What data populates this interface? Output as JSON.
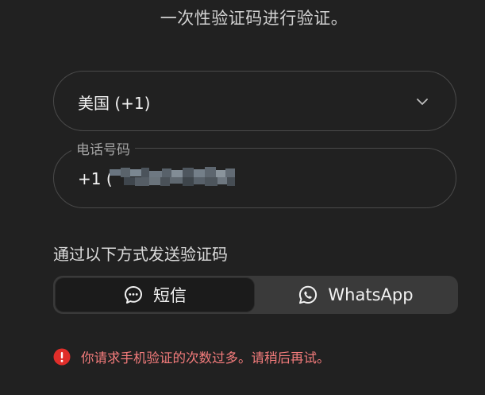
{
  "header": {
    "subtitle": "一次性验证码进行验证。"
  },
  "country": {
    "selected": "美国 (+1)",
    "icon": "chevron-down-icon"
  },
  "phone": {
    "label": "电话号码",
    "prefix": "+1 (",
    "value_redacted": true
  },
  "send_method": {
    "label": "通过以下方式发送验证码",
    "options": [
      {
        "label": "短信",
        "icon": "message-icon",
        "selected": true
      },
      {
        "label": "WhatsApp",
        "icon": "whatsapp-icon",
        "selected": false
      }
    ]
  },
  "error": {
    "icon": "alert-icon",
    "message": "你请求手机验证的次数过多。请稍后再试。",
    "color": "#f47c7c",
    "icon_color": "#e02e2a"
  },
  "colors": {
    "background": "#212121",
    "segment_bg": "#3a3a3a",
    "segment_active": "#1b1b1b"
  }
}
